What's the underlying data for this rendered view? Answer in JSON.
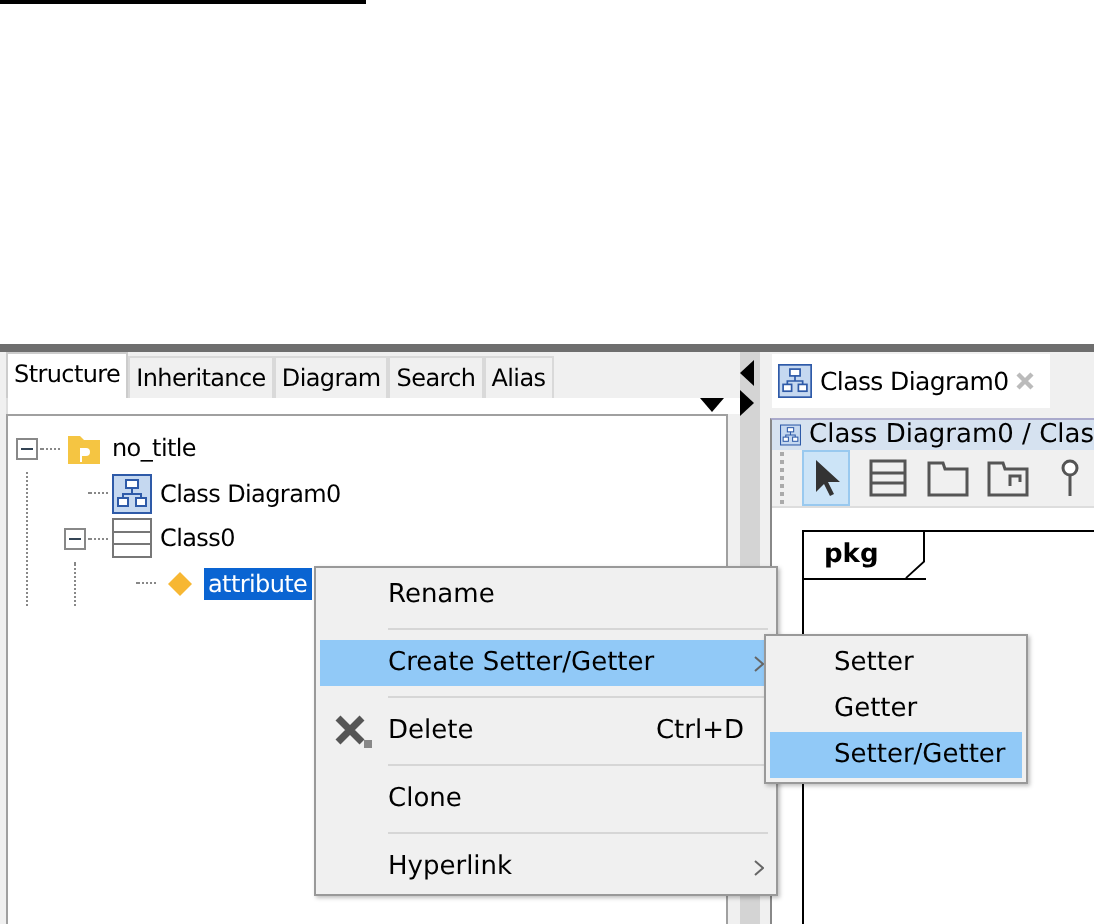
{
  "left_panel": {
    "tabs": [
      {
        "label": "Structure",
        "selected": true
      },
      {
        "label": "Inheritance",
        "selected": false
      },
      {
        "label": "Diagram",
        "selected": false
      },
      {
        "label": "Search",
        "selected": false
      },
      {
        "label": "Alias",
        "selected": false
      }
    ],
    "tree": [
      {
        "label": "no_title",
        "kind": "project",
        "expanded": true,
        "selected": false,
        "children": [
          {
            "label": "Class Diagram0",
            "kind": "diagram",
            "selected": false
          },
          {
            "label": "Class0",
            "kind": "class",
            "expanded": true,
            "selected": false,
            "children": [
              {
                "label": "attribute",
                "kind": "attribute",
                "selected": true
              }
            ]
          }
        ]
      }
    ]
  },
  "editor": {
    "tabs": [
      {
        "label": "Class Diagram0",
        "selected": true
      }
    ],
    "header": "Class Diagram0 / Clas",
    "tools": [
      {
        "kind": "pointer",
        "selected": true
      },
      {
        "kind": "class",
        "selected": false
      },
      {
        "kind": "package",
        "selected": false
      },
      {
        "kind": "subsystem",
        "selected": false
      },
      {
        "kind": "pin",
        "selected": false
      }
    ],
    "frame_label": "pkg"
  },
  "context_menu": {
    "items": [
      {
        "label": "Rename",
        "kind": "plain",
        "submenu": false,
        "selected": false
      },
      {
        "label": "Create Setter/Getter",
        "kind": "plain",
        "submenu": true,
        "selected": true
      },
      {
        "label": "Delete",
        "shortcut": "Ctrl+D",
        "kind": "delete",
        "submenu": false,
        "selected": false
      },
      {
        "label": "Clone",
        "kind": "plain",
        "submenu": false,
        "selected": false
      },
      {
        "label": "Hyperlink",
        "kind": "plain",
        "submenu": true,
        "selected": false
      }
    ]
  },
  "submenu": {
    "items": [
      {
        "label": "Setter",
        "selected": false
      },
      {
        "label": "Getter",
        "selected": false
      },
      {
        "label": "Setter/Getter",
        "selected": true
      }
    ]
  }
}
